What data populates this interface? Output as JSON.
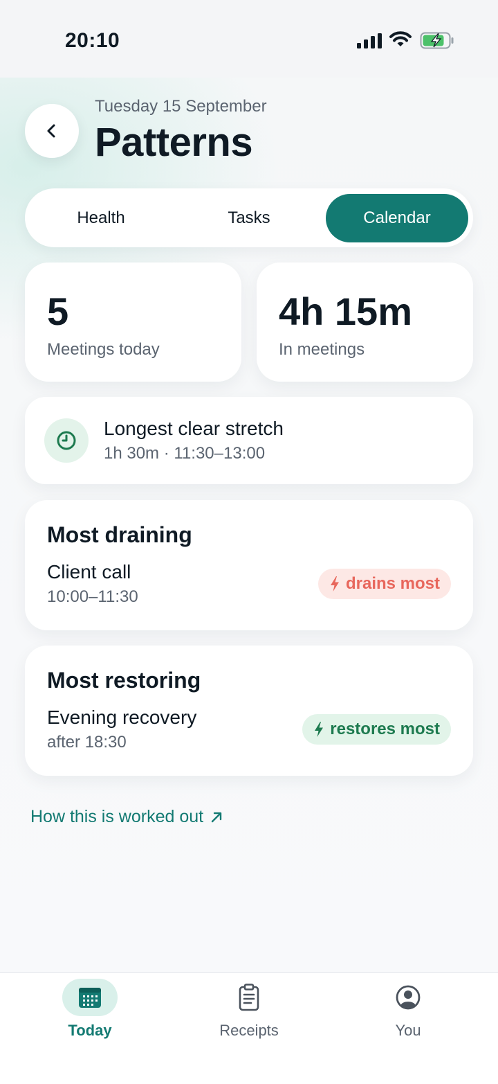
{
  "status_bar": {
    "time": "20:10"
  },
  "header": {
    "date": "Tuesday 15 September",
    "title": "Patterns"
  },
  "tabs": [
    {
      "label": "Health",
      "selected": false
    },
    {
      "label": "Tasks",
      "selected": false
    },
    {
      "label": "Calendar",
      "selected": true
    }
  ],
  "stats": {
    "meetings_count": "5",
    "meetings_label": "Meetings today",
    "in_meetings_value": "4h 15m",
    "in_meetings_label": "In meetings"
  },
  "clear_stretch": {
    "title": "Longest clear stretch",
    "detail": "1h 30m · 11:30–13:00"
  },
  "most_draining": {
    "heading": "Most draining",
    "name": "Client call",
    "time": "10:00–11:30",
    "badge": "drains most"
  },
  "most_restoring": {
    "heading": "Most restoring",
    "name": "Evening recovery",
    "time": "after 18:30",
    "badge": "restores most"
  },
  "explain_link": "How this is worked out",
  "bottom_nav": [
    {
      "label": "Today",
      "icon": "calendar-icon",
      "active": true
    },
    {
      "label": "Receipts",
      "icon": "receipt-icon",
      "active": false
    },
    {
      "label": "You",
      "icon": "profile-icon",
      "active": false
    }
  ],
  "colors": {
    "accent": "#137a72",
    "drain": "#e8675c",
    "drain_bg": "#fde8e5",
    "restore": "#1d7a4f",
    "restore_bg": "#e2f4e9"
  }
}
